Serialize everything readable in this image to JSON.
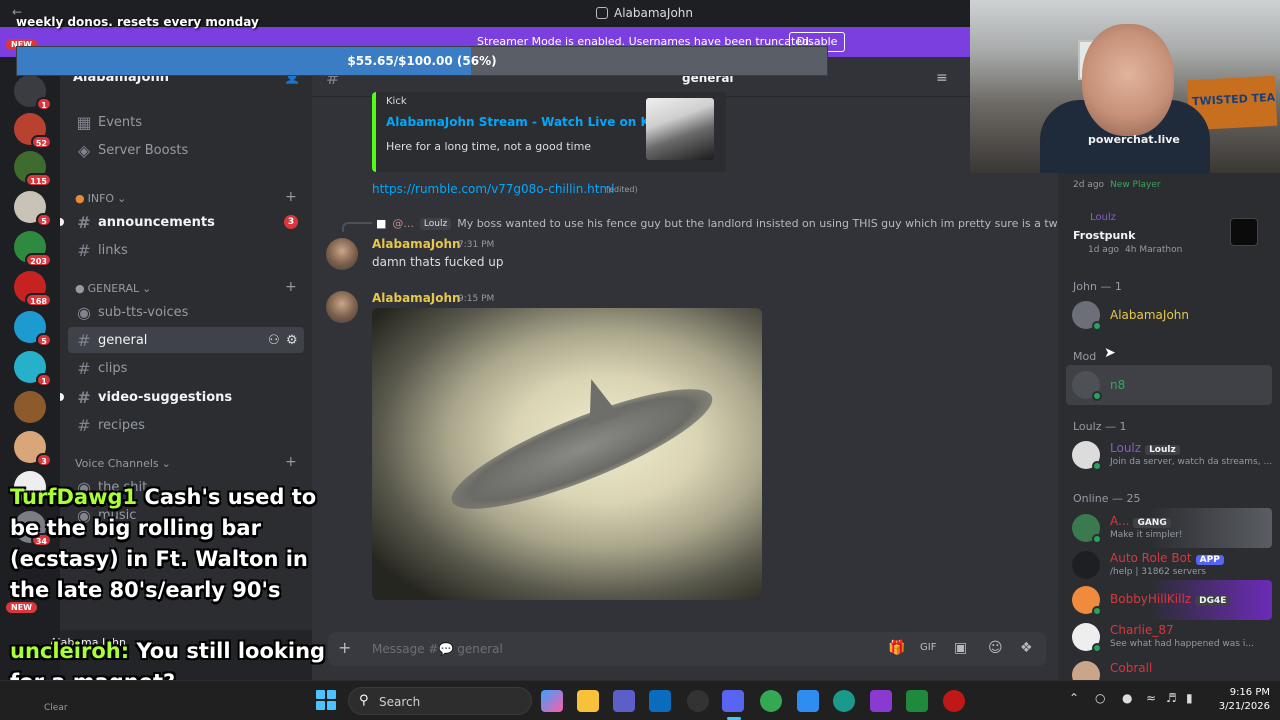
{
  "window": {
    "back": "←",
    "title": "AlabamaJohn"
  },
  "streamer_banner": {
    "text": "Streamer Mode is enabled. Usernames have been truncated.",
    "button": "Disable"
  },
  "donation": {
    "title": "weekly donos. resets every monday",
    "progress_label": "$55.65/$100.00 (56%)",
    "progress": 0.56
  },
  "server_rail": {
    "items": [
      {
        "badge": "1",
        "color": "#3a3c42"
      },
      {
        "badge": "52",
        "color": "#b8412f"
      },
      {
        "badge": "115",
        "color": "#3f6b2e"
      },
      {
        "badge": "5",
        "color": "#c9c3b7"
      },
      {
        "badge": "203",
        "color": "#2d8a3e"
      },
      {
        "badge": "168",
        "color": "#c72222"
      },
      {
        "badge": "5",
        "color": "#1d9bd1"
      },
      {
        "badge": "1",
        "color": "#27b0c9"
      },
      {
        "badge": "",
        "color": "#8d5a2b"
      },
      {
        "badge": "3",
        "color": "#d9a679"
      },
      {
        "badge": "",
        "color": "#eeeeee"
      },
      {
        "badge": "34",
        "color": "#7a7d84"
      }
    ],
    "new_label": "NEW"
  },
  "sidebar": {
    "server_name": "AlabamaJohn",
    "items": [
      {
        "label": "Events",
        "icon": "calendar-icon"
      },
      {
        "label": "Server Boosts",
        "icon": "boost-icon"
      }
    ],
    "categories": {
      "info": "INFO",
      "general": "GENERAL",
      "voice": "Voice Channels"
    },
    "channels": {
      "announcements": "announcements",
      "announcements_badge": "3",
      "links": "links",
      "sub_tts": "sub-tts-voices",
      "general": "general",
      "clips": "clips",
      "video_suggestions": "video-suggestions",
      "recipes": "recipes",
      "voice1": "the shit",
      "voice2": "music"
    },
    "user_panel": {
      "name": "Alabama John",
      "status": "Online"
    }
  },
  "chat": {
    "channel": "general",
    "embed": {
      "provider": "Kick",
      "title": "AlabamaJohn Stream - Watch Live on Kick",
      "description": "Here for a long time, not a good time"
    },
    "link": "https://rumble.com/v77g08o-chillin.html",
    "edited": "(edited)",
    "reply": {
      "name": "Loulz",
      "text": "My boss wanted to use his fence guy but the landlord insisted on using THIS guy which im pretty sure is a tweaker"
    },
    "messages": [
      {
        "author": "AlabamaJohn",
        "time": "7:31 PM",
        "text": "damn thats fucked up"
      },
      {
        "author": "AlabamaJohn",
        "time": "9:15 PM",
        "text": ""
      }
    ],
    "composer_placeholder": "Message #💬 general"
  },
  "members": {
    "activities": [
      {
        "name": "Ghost of Yotei Legends",
        "time": "2d ago",
        "extra": "New Player"
      },
      {
        "user": "Loulz",
        "game": "Frostpunk",
        "time": "1d ago",
        "extra": "4h Marathon"
      }
    ],
    "groups": {
      "john": "John — 1",
      "mod": "Mod",
      "loulz": "Loulz — 1",
      "online": "Online — 25"
    },
    "list": [
      {
        "name": "AlabamaJohn",
        "status": "",
        "color": "#e6c84d"
      },
      {
        "name": "n8",
        "status": "",
        "color": "#3ba55c"
      },
      {
        "name": "Loulz",
        "tag": "Loulz",
        "status": "Join da server, watch da streams, ...",
        "color": "#8a5cc4"
      },
      {
        "name": "A...",
        "tag": "GANG",
        "status": "Make it simpler!",
        "color": "#da373c"
      },
      {
        "name": "Auto Role Bot",
        "tag": "APP",
        "status": "/help | 31862 servers",
        "color": "#da373c"
      },
      {
        "name": "BobbyHillKillz",
        "tag": "DG4E",
        "status": "",
        "color": "#da373c"
      },
      {
        "name": "Charlie_87",
        "status": "See what had happened was i...",
        "color": "#da373c"
      },
      {
        "name": "Cobrall",
        "status": "",
        "color": "#da373c"
      }
    ]
  },
  "overlay": {
    "msg1_user": "TurfDawg1",
    "msg1_text": "Cash's used to be the big rolling bar (ecstasy) in Ft. Walton in the late 80's/early 90's",
    "msg2_user": "uncleiroh:",
    "msg2_text": "You still looking for a magnet?",
    "clear": "Clear"
  },
  "webcam": {
    "shirt": "powerchat.live",
    "sign": "TWISTED TEA"
  },
  "taskbar": {
    "search": "Search",
    "time": "9:16 PM",
    "date": "3/21/2026"
  }
}
